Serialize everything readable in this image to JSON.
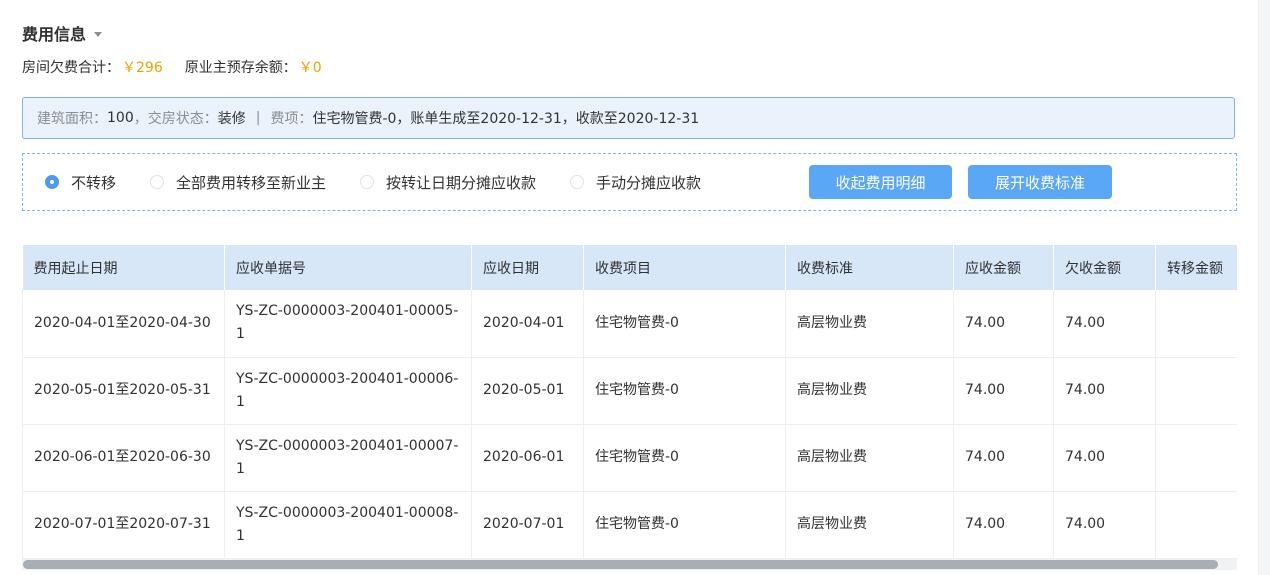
{
  "section": {
    "title": "费用信息"
  },
  "summary": {
    "arrears_label": "房间欠费合计：",
    "arrears_value": "￥296",
    "prepaid_label": "原业主预存余额：",
    "prepaid_value": "￥0"
  },
  "info": {
    "area_label": "建筑面积：",
    "area_value": "100",
    "status_label": "，交房状态：",
    "status_value": "装修",
    "separator": "|",
    "item_label": "费项：",
    "item_value": "住宅物管费-0，账单生成至2020-12-31，收款至2020-12-31"
  },
  "options": {
    "radios": [
      {
        "label": "不转移",
        "checked": true
      },
      {
        "label": "全部费用转移至新业主",
        "checked": false
      },
      {
        "label": "按转让日期分摊应收款",
        "checked": false
      },
      {
        "label": "手动分摊应收款",
        "checked": false
      }
    ],
    "collapse_button": "收起费用明细",
    "expand_button": "展开收费标准"
  },
  "table": {
    "columns": [
      "费用起止日期",
      "应收单据号",
      "应收日期",
      "收费项目",
      "收费标准",
      "应收金额",
      "欠收金额",
      "转移金额"
    ],
    "rows": [
      [
        "2020-04-01至2020-04-30",
        "YS-ZC-0000003-200401-00005-1",
        "2020-04-01",
        "住宅物管费-0",
        "高层物业费",
        "74.00",
        "74.00",
        ""
      ],
      [
        "2020-05-01至2020-05-31",
        "YS-ZC-0000003-200401-00006-1",
        "2020-05-01",
        "住宅物管费-0",
        "高层物业费",
        "74.00",
        "74.00",
        ""
      ],
      [
        "2020-06-01至2020-06-30",
        "YS-ZC-0000003-200401-00007-1",
        "2020-06-01",
        "住宅物管费-0",
        "高层物业费",
        "74.00",
        "74.00",
        ""
      ],
      [
        "2020-07-01至2020-07-31",
        "YS-ZC-0000003-200401-00008-1",
        "2020-07-01",
        "住宅物管费-0",
        "高层物业费",
        "74.00",
        "74.00",
        ""
      ]
    ]
  },
  "colors": {
    "accent": "#5aa7f5",
    "money": "#f2a100",
    "header_bg": "#d7e7f8",
    "info_bg": "#eaf3fc"
  }
}
